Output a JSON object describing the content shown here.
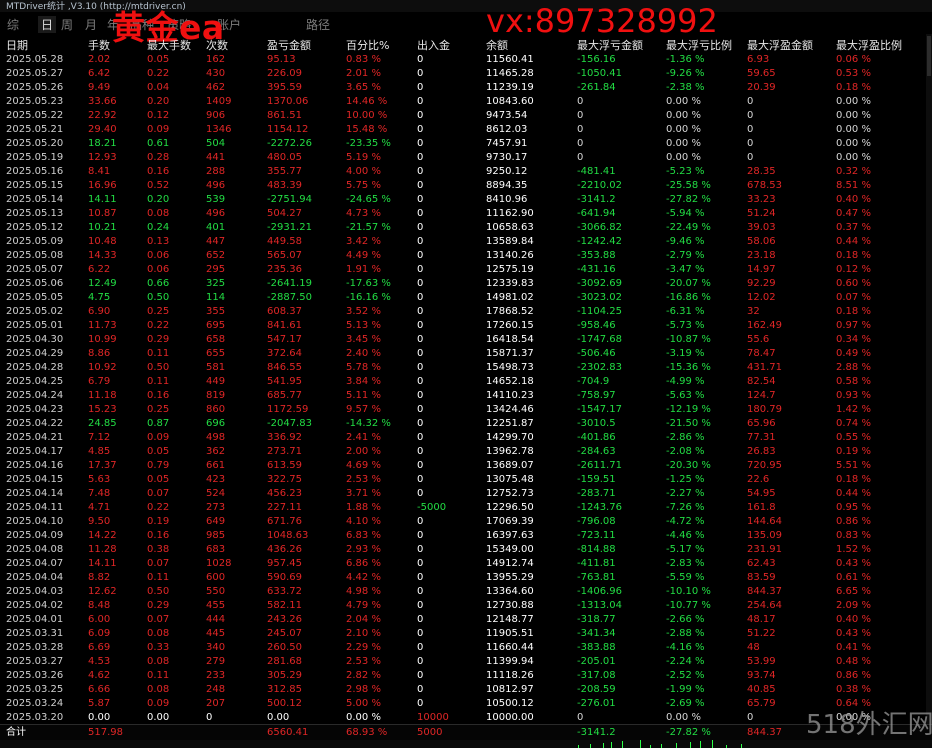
{
  "window": {
    "title": "MTDriver统计 ,V3.10 (http://mtdriver.cn)"
  },
  "tabs": [
    "综",
    "日",
    "周",
    "月",
    "年",
    "品种",
    "策略",
    "账户",
    "路径"
  ],
  "active_tab": 1,
  "overlay": {
    "text1": "黄金ea",
    "text2": "vx:897328992"
  },
  "watermark": "518外汇网",
  "colors": {
    "background": "#000000",
    "profit": "#e02626",
    "loss": "#22dd44",
    "overlay_red": "#f01010"
  },
  "columns": [
    "日期",
    "手数",
    "最大手数",
    "次数",
    "盈亏金额",
    "百分比%",
    "出入金",
    "余额",
    "最大浮亏金额",
    "最大浮亏比例",
    "最大浮盈金额",
    "最大浮盈比例"
  ],
  "rows": [
    [
      "2025.05.28",
      "2.02",
      "0.05",
      "162",
      "95.13",
      "0.83 %",
      "0",
      "11560.41",
      "-156.16",
      "-1.36 %",
      "6.93",
      "0.06 %"
    ],
    [
      "2025.05.27",
      "6.42",
      "0.22",
      "430",
      "226.09",
      "2.01 %",
      "0",
      "11465.28",
      "-1050.41",
      "-9.26 %",
      "59.65",
      "0.53 %"
    ],
    [
      "2025.05.26",
      "9.49",
      "0.04",
      "462",
      "395.59",
      "3.65 %",
      "0",
      "11239.19",
      "-261.84",
      "-2.38 %",
      "20.39",
      "0.18 %"
    ],
    [
      "2025.05.23",
      "33.66",
      "0.20",
      "1409",
      "1370.06",
      "14.46 %",
      "0",
      "10843.60",
      "0",
      "0.00 %",
      "0",
      "0.00 %"
    ],
    [
      "2025.05.22",
      "22.92",
      "0.12",
      "906",
      "861.51",
      "10.00 %",
      "0",
      "9473.54",
      "0",
      "0.00 %",
      "0",
      "0.00 %"
    ],
    [
      "2025.05.21",
      "29.40",
      "0.09",
      "1346",
      "1154.12",
      "15.48 %",
      "0",
      "8612.03",
      "0",
      "0.00 %",
      "0",
      "0.00 %"
    ],
    [
      "2025.05.20",
      "18.21",
      "0.61",
      "504",
      "-2272.26",
      "-23.35 %",
      "0",
      "7457.91",
      "0",
      "0.00 %",
      "0",
      "0.00 %"
    ],
    [
      "2025.05.19",
      "12.93",
      "0.28",
      "441",
      "480.05",
      "5.19 %",
      "0",
      "9730.17",
      "0",
      "0.00 %",
      "0",
      "0.00 %"
    ],
    [
      "2025.05.16",
      "8.41",
      "0.16",
      "288",
      "355.77",
      "4.00 %",
      "0",
      "9250.12",
      "-481.41",
      "-5.23 %",
      "28.35",
      "0.32 %"
    ],
    [
      "2025.05.15",
      "16.96",
      "0.52",
      "496",
      "483.39",
      "5.75 %",
      "0",
      "8894.35",
      "-2210.02",
      "-25.58 %",
      "678.53",
      "8.51 %"
    ],
    [
      "2025.05.14",
      "14.11",
      "0.20",
      "539",
      "-2751.94",
      "-24.65 %",
      "0",
      "8410.96",
      "-3141.2",
      "-27.82 %",
      "33.23",
      "0.40 %"
    ],
    [
      "2025.05.13",
      "10.87",
      "0.08",
      "496",
      "504.27",
      "4.73 %",
      "0",
      "11162.90",
      "-641.94",
      "-5.94 %",
      "51.24",
      "0.47 %"
    ],
    [
      "2025.05.12",
      "10.21",
      "0.24",
      "401",
      "-2931.21",
      "-21.57 %",
      "0",
      "10658.63",
      "-3066.82",
      "-22.49 %",
      "39.03",
      "0.37 %"
    ],
    [
      "2025.05.09",
      "10.48",
      "0.13",
      "447",
      "449.58",
      "3.42 %",
      "0",
      "13589.84",
      "-1242.42",
      "-9.46 %",
      "58.06",
      "0.44 %"
    ],
    [
      "2025.05.08",
      "14.33",
      "0.06",
      "652",
      "565.07",
      "4.49 %",
      "0",
      "13140.26",
      "-353.88",
      "-2.79 %",
      "23.18",
      "0.18 %"
    ],
    [
      "2025.05.07",
      "6.22",
      "0.06",
      "295",
      "235.36",
      "1.91 %",
      "0",
      "12575.19",
      "-431.16",
      "-3.47 %",
      "14.97",
      "0.12 %"
    ],
    [
      "2025.05.06",
      "12.49",
      "0.66",
      "325",
      "-2641.19",
      "-17.63 %",
      "0",
      "12339.83",
      "-3092.69",
      "-20.07 %",
      "92.29",
      "0.60 %"
    ],
    [
      "2025.05.05",
      "4.75",
      "0.50",
      "114",
      "-2887.50",
      "-16.16 %",
      "0",
      "14981.02",
      "-3023.02",
      "-16.86 %",
      "12.02",
      "0.07 %"
    ],
    [
      "2025.05.02",
      "6.90",
      "0.25",
      "355",
      "608.37",
      "3.52 %",
      "0",
      "17868.52",
      "-1104.25",
      "-6.31 %",
      "32",
      "0.18 %"
    ],
    [
      "2025.05.01",
      "11.73",
      "0.22",
      "695",
      "841.61",
      "5.13 %",
      "0",
      "17260.15",
      "-958.46",
      "-5.73 %",
      "162.49",
      "0.97 %"
    ],
    [
      "2025.04.30",
      "10.99",
      "0.29",
      "658",
      "547.17",
      "3.45 %",
      "0",
      "16418.54",
      "-1747.68",
      "-10.87 %",
      "55.6",
      "0.34 %"
    ],
    [
      "2025.04.29",
      "8.86",
      "0.11",
      "655",
      "372.64",
      "2.40 %",
      "0",
      "15871.37",
      "-506.46",
      "-3.19 %",
      "78.47",
      "0.49 %"
    ],
    [
      "2025.04.28",
      "10.92",
      "0.50",
      "581",
      "846.55",
      "5.78 %",
      "0",
      "15498.73",
      "-2302.83",
      "-15.36 %",
      "431.71",
      "2.88 %"
    ],
    [
      "2025.04.25",
      "6.79",
      "0.11",
      "449",
      "541.95",
      "3.84 %",
      "0",
      "14652.18",
      "-704.9",
      "-4.99 %",
      "82.54",
      "0.58 %"
    ],
    [
      "2025.04.24",
      "11.18",
      "0.16",
      "819",
      "685.77",
      "5.11 %",
      "0",
      "14110.23",
      "-758.97",
      "-5.63 %",
      "124.7",
      "0.93 %"
    ],
    [
      "2025.04.23",
      "15.23",
      "0.25",
      "860",
      "1172.59",
      "9.57 %",
      "0",
      "13424.46",
      "-1547.17",
      "-12.19 %",
      "180.79",
      "1.42 %"
    ],
    [
      "2025.04.22",
      "24.85",
      "0.87",
      "696",
      "-2047.83",
      "-14.32 %",
      "0",
      "12251.87",
      "-3010.5",
      "-21.50 %",
      "65.96",
      "0.74 %"
    ],
    [
      "2025.04.21",
      "7.12",
      "0.09",
      "498",
      "336.92",
      "2.41 %",
      "0",
      "14299.70",
      "-401.86",
      "-2.86 %",
      "77.31",
      "0.55 %"
    ],
    [
      "2025.04.17",
      "4.85",
      "0.05",
      "362",
      "273.71",
      "2.00 %",
      "0",
      "13962.78",
      "-284.63",
      "-2.08 %",
      "26.83",
      "0.19 %"
    ],
    [
      "2025.04.16",
      "17.37",
      "0.79",
      "661",
      "613.59",
      "4.69 %",
      "0",
      "13689.07",
      "-2611.71",
      "-20.30 %",
      "720.95",
      "5.51 %"
    ],
    [
      "2025.04.15",
      "5.63",
      "0.05",
      "423",
      "322.75",
      "2.53 %",
      "0",
      "13075.48",
      "-159.51",
      "-1.25 %",
      "22.6",
      "0.18 %"
    ],
    [
      "2025.04.14",
      "7.48",
      "0.07",
      "524",
      "456.23",
      "3.71 %",
      "0",
      "12752.73",
      "-283.71",
      "-2.27 %",
      "54.95",
      "0.44 %"
    ],
    [
      "2025.04.11",
      "4.71",
      "0.22",
      "273",
      "227.11",
      "1.88 %",
      "-5000",
      "12296.50",
      "-1243.76",
      "-7.26 %",
      "161.8",
      "0.95 %"
    ],
    [
      "2025.04.10",
      "9.50",
      "0.19",
      "649",
      "671.76",
      "4.10 %",
      "0",
      "17069.39",
      "-796.08",
      "-4.72 %",
      "144.64",
      "0.86 %"
    ],
    [
      "2025.04.09",
      "14.22",
      "0.16",
      "985",
      "1048.63",
      "6.83 %",
      "0",
      "16397.63",
      "-723.11",
      "-4.46 %",
      "135.09",
      "0.83 %"
    ],
    [
      "2025.04.08",
      "11.28",
      "0.38",
      "683",
      "436.26",
      "2.93 %",
      "0",
      "15349.00",
      "-814.88",
      "-5.17 %",
      "231.91",
      "1.52 %"
    ],
    [
      "2025.04.07",
      "14.11",
      "0.07",
      "1028",
      "957.45",
      "6.86 %",
      "0",
      "14912.74",
      "-411.81",
      "-2.83 %",
      "62.43",
      "0.43 %"
    ],
    [
      "2025.04.04",
      "8.82",
      "0.11",
      "600",
      "590.69",
      "4.42 %",
      "0",
      "13955.29",
      "-763.81",
      "-5.59 %",
      "83.59",
      "0.61 %"
    ],
    [
      "2025.04.03",
      "12.62",
      "0.50",
      "550",
      "633.72",
      "4.98 %",
      "0",
      "13364.60",
      "-1406.96",
      "-10.10 %",
      "844.37",
      "6.65 %"
    ],
    [
      "2025.04.02",
      "8.48",
      "0.29",
      "455",
      "582.11",
      "4.79 %",
      "0",
      "12730.88",
      "-1313.04",
      "-10.77 %",
      "254.64",
      "2.09 %"
    ],
    [
      "2025.04.01",
      "6.00",
      "0.07",
      "444",
      "243.26",
      "2.04 %",
      "0",
      "12148.77",
      "-318.77",
      "-2.66 %",
      "48.17",
      "0.40 %"
    ],
    [
      "2025.03.31",
      "6.09",
      "0.08",
      "445",
      "245.07",
      "2.10 %",
      "0",
      "11905.51",
      "-341.34",
      "-2.88 %",
      "51.22",
      "0.43 %"
    ],
    [
      "2025.03.28",
      "6.69",
      "0.33",
      "340",
      "260.50",
      "2.29 %",
      "0",
      "11660.44",
      "-383.88",
      "-4.16 %",
      "48",
      "0.41 %"
    ],
    [
      "2025.03.27",
      "4.53",
      "0.08",
      "279",
      "281.68",
      "2.53 %",
      "0",
      "11399.94",
      "-205.01",
      "-2.24 %",
      "53.99",
      "0.48 %"
    ],
    [
      "2025.03.26",
      "4.62",
      "0.11",
      "233",
      "305.29",
      "2.82 %",
      "0",
      "11118.26",
      "-317.08",
      "-2.52 %",
      "93.74",
      "0.86 %"
    ],
    [
      "2025.03.25",
      "6.66",
      "0.08",
      "248",
      "312.85",
      "2.98 %",
      "0",
      "10812.97",
      "-208.59",
      "-1.99 %",
      "40.85",
      "0.38 %"
    ],
    [
      "2025.03.24",
      "5.87",
      "0.09",
      "207",
      "500.12",
      "5.00 %",
      "0",
      "10500.12",
      "-276.01",
      "-2.69 %",
      "65.79",
      "0.64 %"
    ],
    [
      "2025.03.20",
      "0.00",
      "0.00",
      "0",
      "0.00",
      "0.00 %",
      "10000",
      "10000.00",
      "0",
      "0.00 %",
      "0",
      "0.00 %"
    ]
  ],
  "total": [
    "合计",
    "517.98",
    "",
    "",
    "6560.41",
    "68.93 %",
    "5000",
    "",
    "-3141.2",
    "-27.82 %",
    "844.37",
    ""
  ]
}
